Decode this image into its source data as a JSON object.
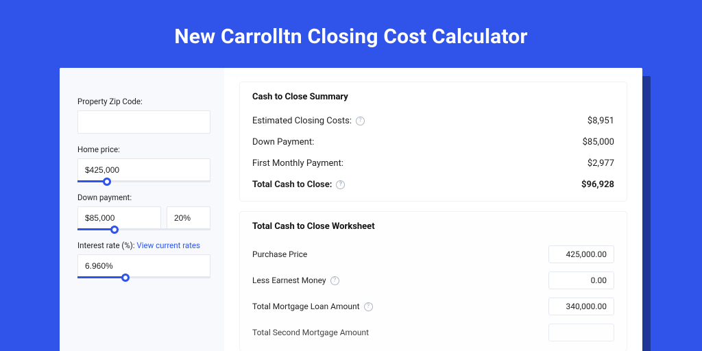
{
  "page": {
    "title": "New Carrolltn Closing Cost Calculator"
  },
  "inputs": {
    "zip_label": "Property Zip Code:",
    "zip_value": "",
    "home_price_label": "Home price:",
    "home_price_value": "$425,000",
    "home_price_pct": 22,
    "down_payment_label": "Down payment:",
    "down_payment_value": "$85,000",
    "down_payment_pct_value": "20%",
    "down_payment_slider_pct": 28,
    "interest_label": "Interest rate (%): ",
    "interest_link": "View current rates",
    "interest_value": "6.960%",
    "interest_slider_pct": 36
  },
  "summary": {
    "title": "Cash to Close Summary",
    "rows": [
      {
        "label": "Estimated Closing Costs:",
        "help": true,
        "value": "$8,951",
        "bold": false
      },
      {
        "label": "Down Payment:",
        "help": false,
        "value": "$85,000",
        "bold": false
      },
      {
        "label": "First Monthly Payment:",
        "help": false,
        "value": "$2,977",
        "bold": false
      },
      {
        "label": "Total Cash to Close:",
        "help": true,
        "value": "$96,928",
        "bold": true
      }
    ]
  },
  "worksheet": {
    "title": "Total Cash to Close Worksheet",
    "rows": [
      {
        "label": "Purchase Price",
        "help": false,
        "value": "425,000.00"
      },
      {
        "label": "Less Earnest Money",
        "help": true,
        "value": "0.00"
      },
      {
        "label": "Total Mortgage Loan Amount",
        "help": true,
        "value": "340,000.00"
      }
    ]
  }
}
